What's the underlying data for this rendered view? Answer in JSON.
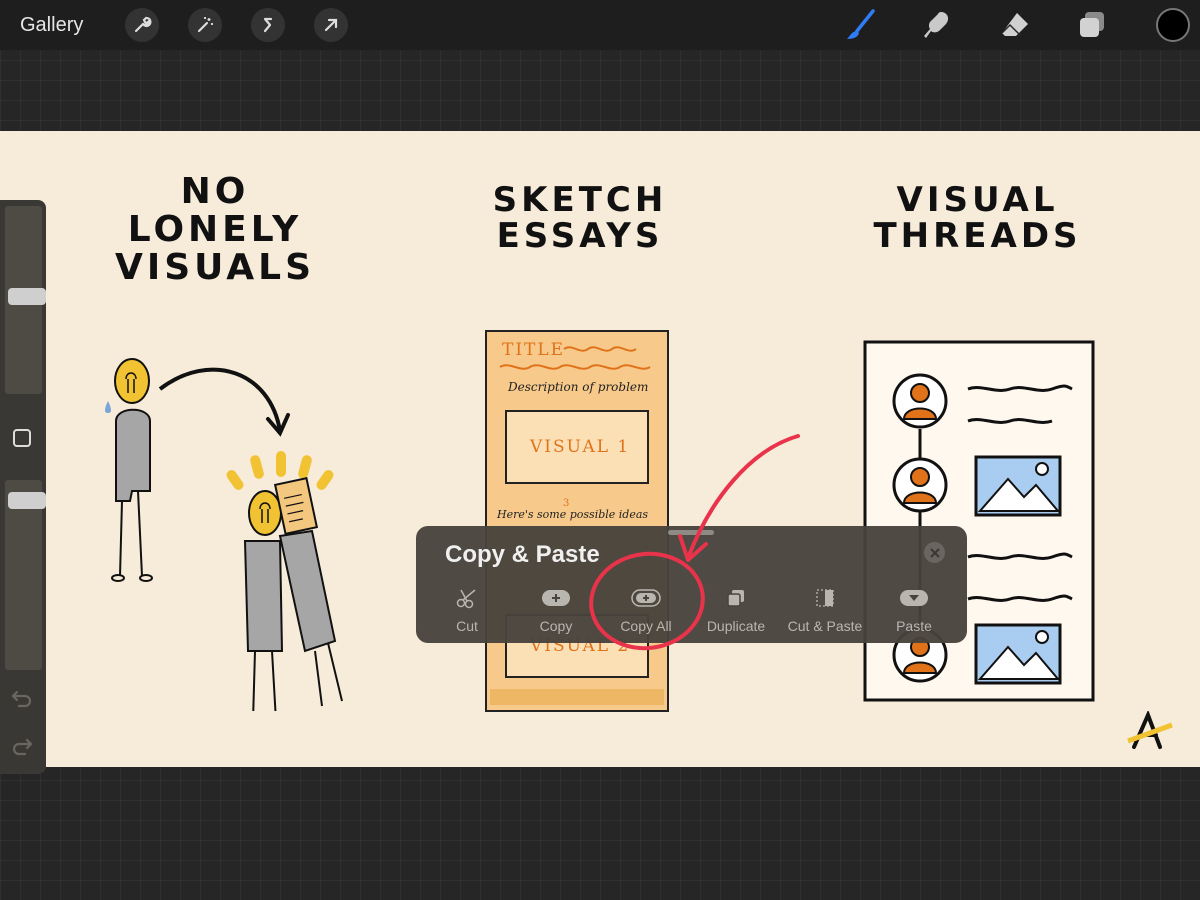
{
  "topbar": {
    "gallery_label": "Gallery",
    "left_tools": [
      "wrench-icon",
      "magic-wand-icon",
      "selection-icon",
      "transform-arrow-icon"
    ],
    "right_tools": [
      "brush-icon",
      "smudge-icon",
      "eraser-icon",
      "layers-icon"
    ],
    "active_tool": "brush-icon",
    "active_color": "#000000",
    "accent": "#2f7cf6"
  },
  "sidebar": {
    "brush_size": 0.48,
    "opacity": 0.93
  },
  "canvas": {
    "col1_title": [
      "NO",
      "LONELY",
      "VISUALS"
    ],
    "col2_title": [
      "SKETCH",
      "ESSAYS"
    ],
    "col3_title": [
      "VISUAL",
      "THREADS"
    ],
    "essay": {
      "title": "TITLE",
      "description": "Description of problem",
      "visual1": "VISUAL 1",
      "ideas": "Here's some possible ideas",
      "superscript": "3",
      "visual2": "VISUAL 2"
    },
    "signature": "A"
  },
  "popup": {
    "title": "Copy & Paste",
    "actions": [
      {
        "label": "Cut",
        "icon": "scissors-icon"
      },
      {
        "label": "Copy",
        "icon": "plus-pill-icon"
      },
      {
        "label": "Copy All",
        "icon": "plus-pill-outline-icon"
      },
      {
        "label": "Duplicate",
        "icon": "duplicate-icon"
      },
      {
        "label": "Cut & Paste",
        "icon": "cut-paste-icon"
      },
      {
        "label": "Paste",
        "icon": "paste-down-icon"
      }
    ],
    "highlight_color": "#e8334a"
  }
}
